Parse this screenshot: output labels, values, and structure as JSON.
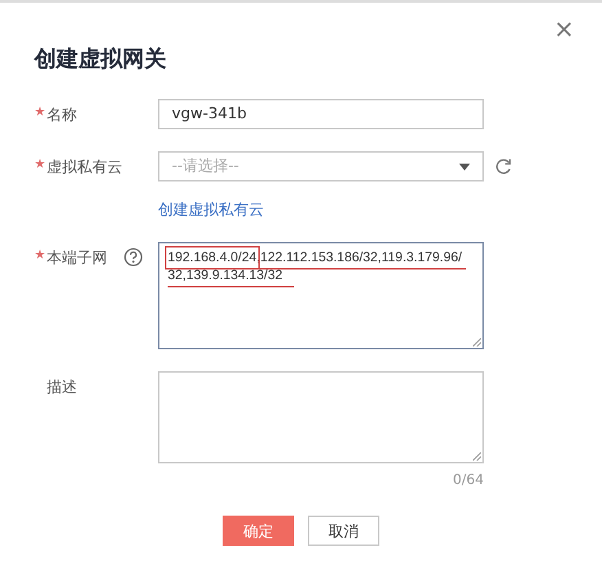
{
  "dialog": {
    "title": "创建虚拟网关",
    "close": "×",
    "required_mark": "★"
  },
  "fields": [
    {
      "kind": "text",
      "label": "名称",
      "required": true,
      "value": "vgw-341b"
    },
    {
      "kind": "select",
      "label": "虚拟私有云",
      "required": true,
      "placeholder": "--请选择--",
      "link": "创建虚拟私有云"
    },
    {
      "kind": "textarea",
      "label": "本端子网",
      "required": true,
      "help": true,
      "value": "192.168.4.0/24,122.112.153.186/32,119.3.179.96/32,139.9.134.13/32",
      "annotated": true
    },
    {
      "kind": "textarea",
      "label": "描述",
      "required": false,
      "counter": "0/64"
    }
  ],
  "buttons": [
    {
      "label": "确定",
      "kind": "primary"
    },
    {
      "label": "取消",
      "kind": "secondary"
    }
  ]
}
